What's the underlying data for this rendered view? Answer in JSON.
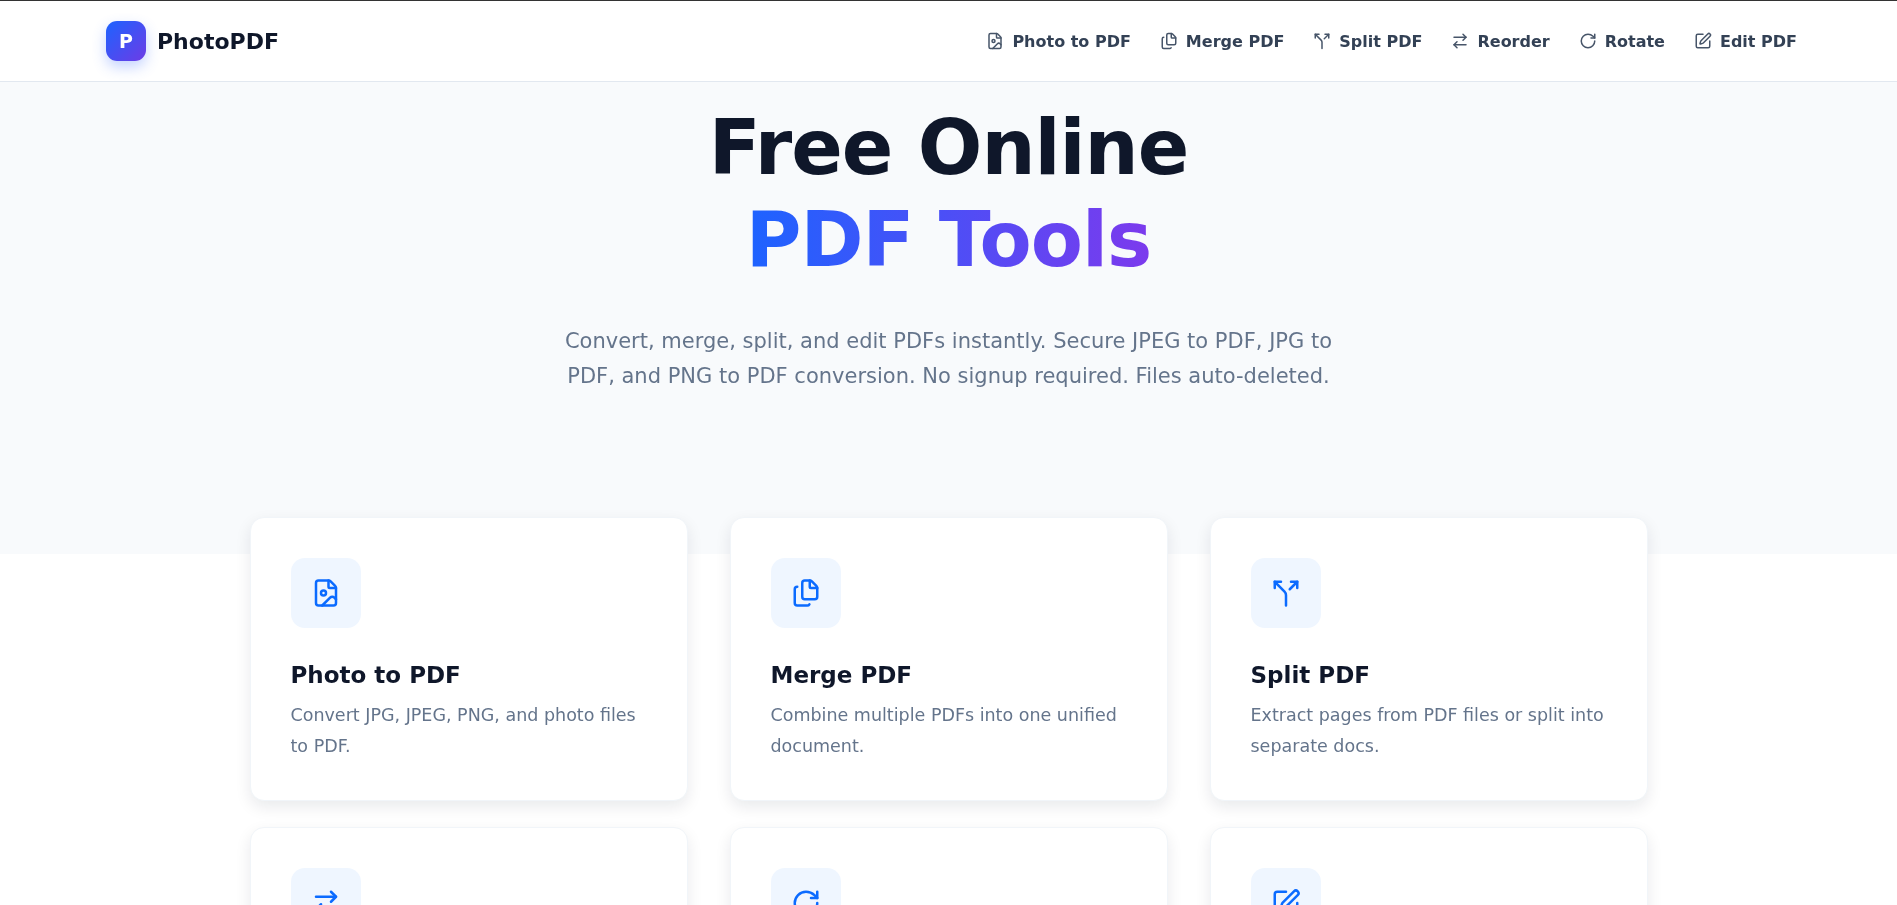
{
  "brand": {
    "mark": "P",
    "name": "PhotoPDF"
  },
  "nav": [
    {
      "kind": "photo",
      "label": "Photo to PDF"
    },
    {
      "kind": "merge",
      "label": "Merge PDF"
    },
    {
      "kind": "split",
      "label": "Split PDF"
    },
    {
      "kind": "reorder",
      "label": "Reorder"
    },
    {
      "kind": "rotate",
      "label": "Rotate"
    },
    {
      "kind": "edit",
      "label": "Edit PDF"
    }
  ],
  "hero": {
    "title_line_1": "Free Online",
    "title_line_2": "PDF Tools",
    "subtitle": "Convert, merge, split, and edit PDFs instantly. Secure JPEG to PDF, JPG to PDF, and PNG to PDF conversion. No signup required. Files auto-deleted."
  },
  "tools": [
    {
      "kind": "photo",
      "title": "Photo to PDF",
      "description": "Convert JPG, JPEG, PNG, and photo files to PDF."
    },
    {
      "kind": "merge",
      "title": "Merge PDF",
      "description": "Combine multiple PDFs into one unified document."
    },
    {
      "kind": "split",
      "title": "Split PDF",
      "description": "Extract pages from PDF files or split into separate docs."
    },
    {
      "kind": "reorder"
    },
    {
      "kind": "rotate"
    },
    {
      "kind": "edit"
    }
  ]
}
